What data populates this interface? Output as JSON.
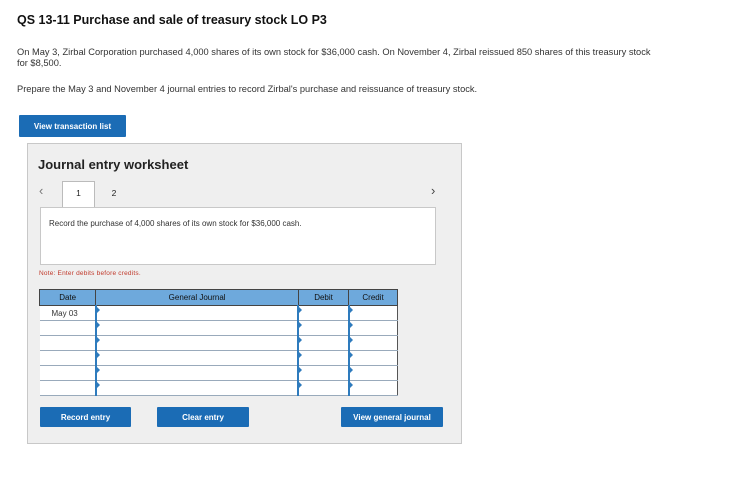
{
  "header": {
    "title": "QS 13-11 Purchase and sale of treasury stock LO P3",
    "para1": "On May 3, Zirbal Corporation purchased 4,000 shares of its own stock for $36,000 cash. On November 4, Zirbal reissued 850 shares of this treasury stock for $8,500.",
    "para2": "Prepare the May 3 and November 4 journal entries to record Zirbal's purchase and reissuance of treasury stock."
  },
  "buttons": {
    "view_transaction_list": "View transaction list",
    "record_entry": "Record entry",
    "clear_entry": "Clear entry",
    "view_general_journal": "View general journal"
  },
  "worksheet": {
    "title": "Journal entry worksheet",
    "prev_icon": "‹",
    "next_icon": "›",
    "tabs": [
      "1",
      "2"
    ],
    "instruction": "Record the purchase of 4,000 shares of its own stock for $36,000 cash.",
    "note": "Note: Enter debits before credits."
  },
  "journal": {
    "headers": {
      "date": "Date",
      "general_journal": "General Journal",
      "debit": "Debit",
      "credit": "Credit"
    },
    "rows": [
      {
        "date": "May 03",
        "account": "",
        "debit": "",
        "credit": ""
      },
      {
        "date": "",
        "account": "",
        "debit": "",
        "credit": ""
      },
      {
        "date": "",
        "account": "",
        "debit": "",
        "credit": ""
      },
      {
        "date": "",
        "account": "",
        "debit": "",
        "credit": ""
      },
      {
        "date": "",
        "account": "",
        "debit": "",
        "credit": ""
      },
      {
        "date": "",
        "account": "",
        "debit": "",
        "credit": ""
      }
    ]
  },
  "colors": {
    "accent": "#1b6cb5",
    "table_header": "#6ea9dc",
    "note": "#c0392b"
  }
}
